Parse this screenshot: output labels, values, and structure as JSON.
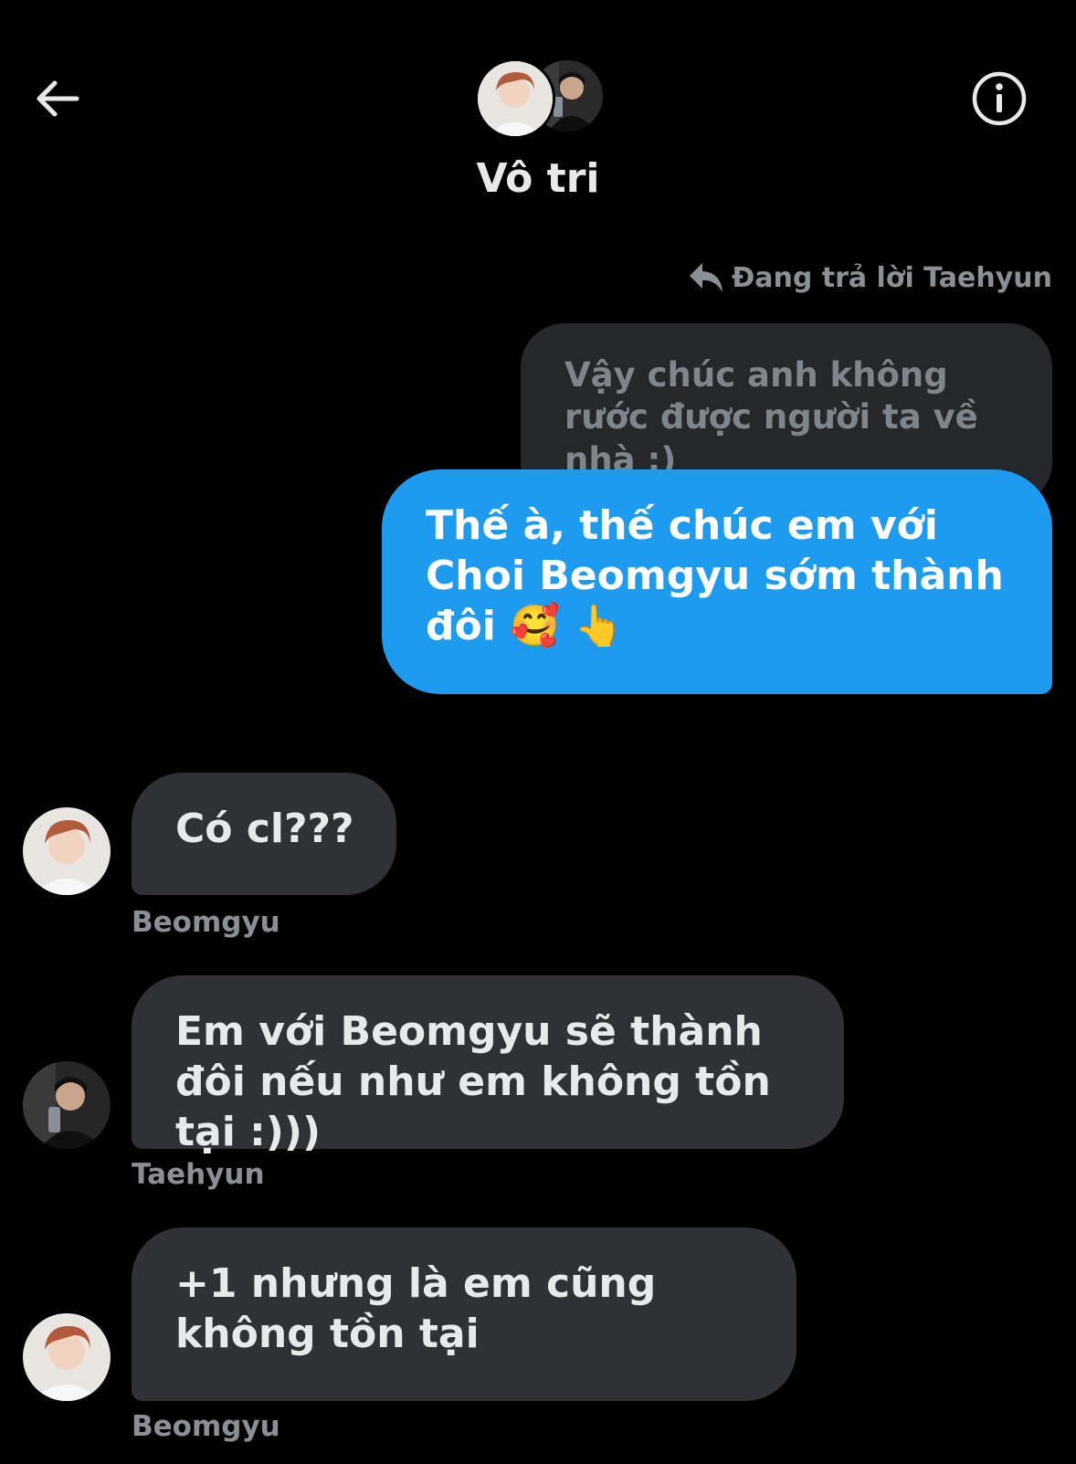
{
  "header": {
    "title": "Vô tri",
    "back_icon": "arrow-left-icon",
    "info_icon": "info-circle-icon"
  },
  "reply_context": {
    "icon": "reply-arrow-icon",
    "label": "Đang trả lời Taehyun"
  },
  "quoted_message": {
    "text": "Vậy chúc anh không rước được người ta về nhà :)"
  },
  "sent_message": {
    "text": "Thế à, thế chúc em với Choi Beomgyu sớm thành đôi 🥰 👆"
  },
  "received_messages": [
    {
      "text": "Có cl???",
      "sender": "Beomgyu"
    },
    {
      "text": "Em với Beomgyu sẽ thành đôi nếu như em không tồn tại :)))",
      "sender": "Taehyun"
    },
    {
      "text": "+1 nhưng là em cũng không tồn tại",
      "sender": "Beomgyu"
    }
  ],
  "colors": {
    "background": "#000000",
    "sent_bubble": "#1d9bf0",
    "received_bubble": "#2f3136",
    "quoted_bubble": "#25272b",
    "muted_text": "#8b9096"
  }
}
